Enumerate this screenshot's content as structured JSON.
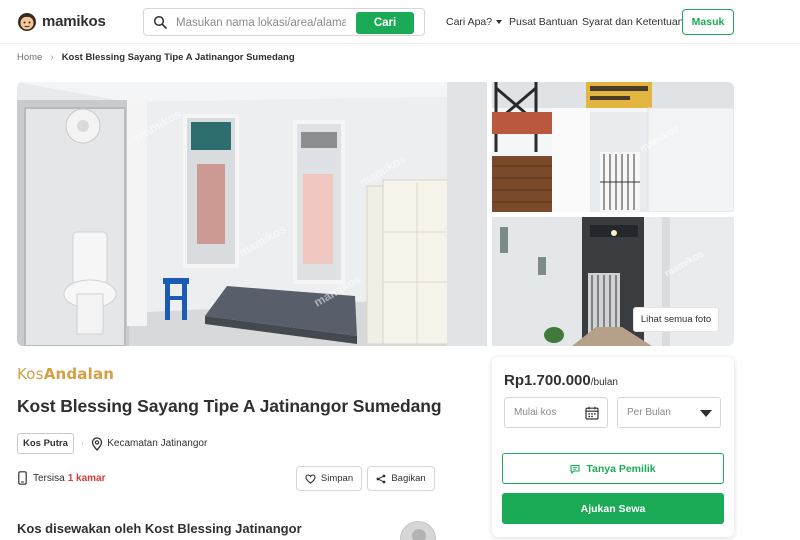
{
  "header": {
    "logo_text": "mamikos",
    "search_placeholder": "Masukan nama lokasi/area/alamat",
    "search_button": "Cari",
    "nav_cari_apa": "Cari Apa?",
    "nav_bantuan": "Pusat Bantuan",
    "nav_syarat": "Syarat dan Ketentuan",
    "login_button": "Masuk"
  },
  "breadcrumb": {
    "home": "Home",
    "current": "Kost Blessing Sayang Tipe A Jatinangor Sumedang"
  },
  "gallery": {
    "watermark": "mamikos",
    "see_all_button": "Lihat semua foto"
  },
  "listing": {
    "brand_part1": "Kos",
    "brand_part2": "Andalan",
    "title": "Kost Blessing Sayang Tipe A Jatinangor Sumedang",
    "type": "Kos Putra",
    "location": "Kecamatan Jatinangor",
    "availability_prefix": "Tersisa",
    "availability_count": "1 kamar",
    "save_button": "Simpan",
    "share_button": "Bagikan",
    "owner_text": "Kos disewakan oleh Kost Blessing Jatinangor"
  },
  "price_card": {
    "price": "Rp1.700.000",
    "unit": "/bulan",
    "date_placeholder": "Mulai kos",
    "period_value": "Per Bulan",
    "ask_owner_button": "Tanya Pemilik",
    "apply_button": "Ajukan Sewa"
  },
  "colors": {
    "brand_green": "#1baa56",
    "andalan_gold": "#d4a043",
    "alert_red": "#d93b3b"
  },
  "icons": [
    "search-icon",
    "calendar-icon",
    "heart-icon",
    "share-icon",
    "location-icon",
    "phone-icon",
    "chat-icon",
    "chevron-right-icon",
    "dropdown-icon"
  ]
}
